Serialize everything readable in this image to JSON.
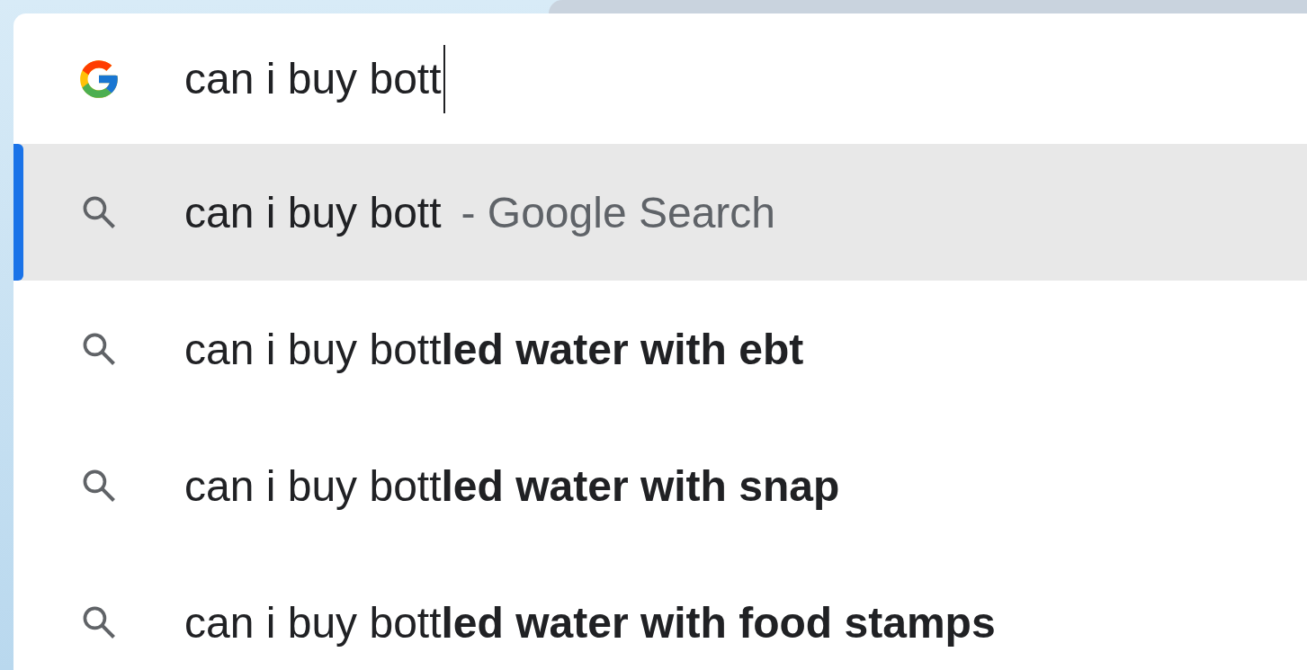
{
  "omnibox": {
    "value": "can i buy bott"
  },
  "suggestions": [
    {
      "query": "can i buy bott",
      "description": "- Google Search",
      "selected": true
    },
    {
      "query": "can i buy bott**led water with ebt**",
      "selected": false
    },
    {
      "query": "can i buy bott**led water with snap**",
      "selected": false
    },
    {
      "query": "can i buy bott**led water with food stamps**",
      "selected": false
    }
  ]
}
